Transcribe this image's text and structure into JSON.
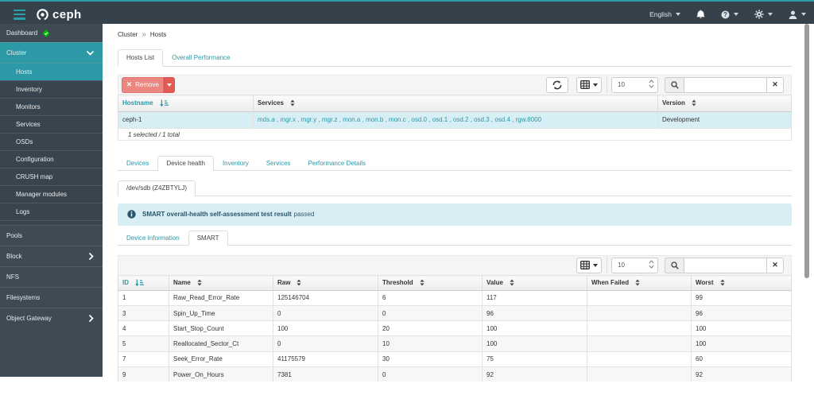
{
  "navbar": {
    "brand": "ceph",
    "language": "English"
  },
  "sidebar": {
    "items": [
      {
        "label": "Dashboard"
      },
      {
        "label": "Cluster"
      },
      {
        "label": "Pools"
      },
      {
        "label": "Block"
      },
      {
        "label": "NFS"
      },
      {
        "label": "Filesystems"
      },
      {
        "label": "Object Gateway"
      }
    ],
    "cluster_children": [
      {
        "label": "Hosts"
      },
      {
        "label": "Inventory"
      },
      {
        "label": "Monitors"
      },
      {
        "label": "Services"
      },
      {
        "label": "OSDs"
      },
      {
        "label": "Configuration"
      },
      {
        "label": "CRUSH map"
      },
      {
        "label": "Manager modules"
      },
      {
        "label": "Logs"
      }
    ]
  },
  "breadcrumb": {
    "parent": "Cluster",
    "current": "Hosts"
  },
  "main_tabs": {
    "tab1": "Hosts List",
    "tab2": "Overall Performance"
  },
  "hosts_table": {
    "remove_label": "Remove",
    "page_size": "10",
    "search_value": "",
    "columns": {
      "c1": "Hostname",
      "c2": "Services",
      "c3": "Version"
    },
    "row": {
      "hostname": "ceph-1",
      "services": "mds.a , mgr.x , mgr.y , mgr.z , mon.a , mon.b , mon.c , osd.0 , osd.1 , osd.2 , osd.3 , osd.4 , rgw.8000",
      "version": "Development"
    },
    "footer": "1 selected / 1 total"
  },
  "detail_tabs": {
    "t1": "Devices",
    "t2": "Device health",
    "t3": "Inventory",
    "t4": "Services",
    "t5": "Performance Details"
  },
  "device_tab": "/dev/sdb (Z4ZBTYLJ)",
  "alert": {
    "bold": "SMART overall-health self-assessment test result",
    "normal": "passed"
  },
  "smart_tabs": {
    "t1": "Device Information",
    "t2": "SMART"
  },
  "smart_table": {
    "page_size": "10",
    "search_value": "",
    "columns": {
      "c1": "ID",
      "c2": "Name",
      "c3": "Raw",
      "c4": "Threshold",
      "c5": "Value",
      "c6": "When Failed",
      "c7": "Worst"
    },
    "rows": [
      {
        "id": "1",
        "name": "Raw_Read_Error_Rate",
        "raw": "125146704",
        "threshold": "6",
        "value": "117",
        "when_failed": "",
        "worst": "99"
      },
      {
        "id": "3",
        "name": "Spin_Up_Time",
        "raw": "0",
        "threshold": "0",
        "value": "96",
        "when_failed": "",
        "worst": "96"
      },
      {
        "id": "4",
        "name": "Start_Stop_Count",
        "raw": "100",
        "threshold": "20",
        "value": "100",
        "when_failed": "",
        "worst": "100"
      },
      {
        "id": "5",
        "name": "Reallocated_Sector_Ct",
        "raw": "0",
        "threshold": "10",
        "value": "100",
        "when_failed": "",
        "worst": "100"
      },
      {
        "id": "7",
        "name": "Seek_Error_Rate",
        "raw": "41175579",
        "threshold": "30",
        "value": "75",
        "when_failed": "",
        "worst": "60"
      },
      {
        "id": "9",
        "name": "Power_On_Hours",
        "raw": "7381",
        "threshold": "0",
        "value": "92",
        "when_failed": "",
        "worst": "92"
      }
    ]
  }
}
